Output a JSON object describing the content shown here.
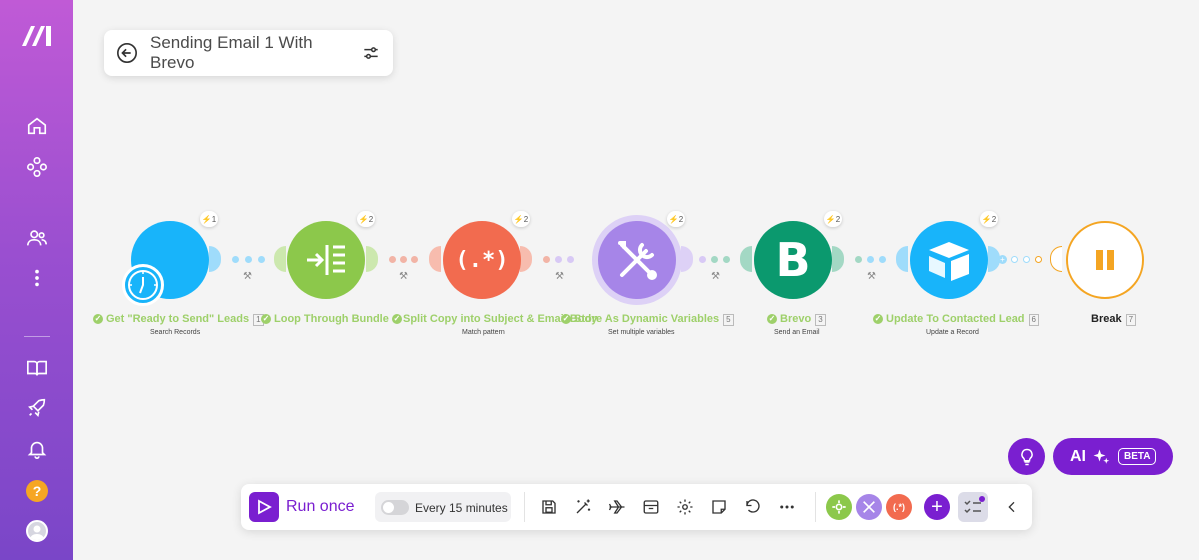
{
  "scenario": {
    "title": "Sending Email 1 With Brevo"
  },
  "sidebar": {
    "items": [
      {
        "icon": "home-icon"
      },
      {
        "icon": "scenarios-icon"
      },
      {
        "icon": "team-icon"
      },
      {
        "icon": "more-icon"
      },
      {
        "icon": "docs-icon"
      },
      {
        "icon": "rocket-icon"
      },
      {
        "icon": "bell-icon"
      }
    ],
    "help_label": "?"
  },
  "modules": [
    {
      "label": "Get \"Ready to Send\" Leads",
      "num": "1",
      "sub": "Search Records",
      "ops": "1",
      "color": "#18b4fa"
    },
    {
      "label": "Loop Through Bundle",
      "num": "",
      "sub": "",
      "ops": "2",
      "color": "#8cc84b"
    },
    {
      "label": "Split Copy into Subject & Email Body",
      "num": "",
      "sub": "Match pattern",
      "ops": "2",
      "color": "#f26b4f",
      "icon_text": "(.*)"
    },
    {
      "label": "Store As Dynamic Variables",
      "num": "5",
      "sub": "Set multiple variables",
      "ops": "2",
      "color": "#a685e8"
    },
    {
      "label": "Brevo",
      "num": "3",
      "sub": "Send an Email",
      "ops": "2",
      "color": "#0b996e",
      "icon_text": "B"
    },
    {
      "label": "Update To Contacted Lead",
      "num": "6",
      "sub": "Update a Record",
      "ops": "2",
      "color": "#18b4fa"
    },
    {
      "label": "Break",
      "num": "7",
      "sub": "",
      "ops": "",
      "color": "#f4a522"
    }
  ],
  "toolbar": {
    "run_label": "Run once",
    "schedule_label": "Every 15 minutes",
    "schedule_enabled": false,
    "mini_icons": [
      {
        "color": "#8cc84b"
      },
      {
        "color": "#a685e8"
      },
      {
        "color": "#f26b4f",
        "text": "(.*)"
      }
    ]
  },
  "ai": {
    "label": "AI",
    "beta": "BETA"
  },
  "colors": {
    "accent": "#7a1fd0",
    "success": "#9ed06a"
  }
}
